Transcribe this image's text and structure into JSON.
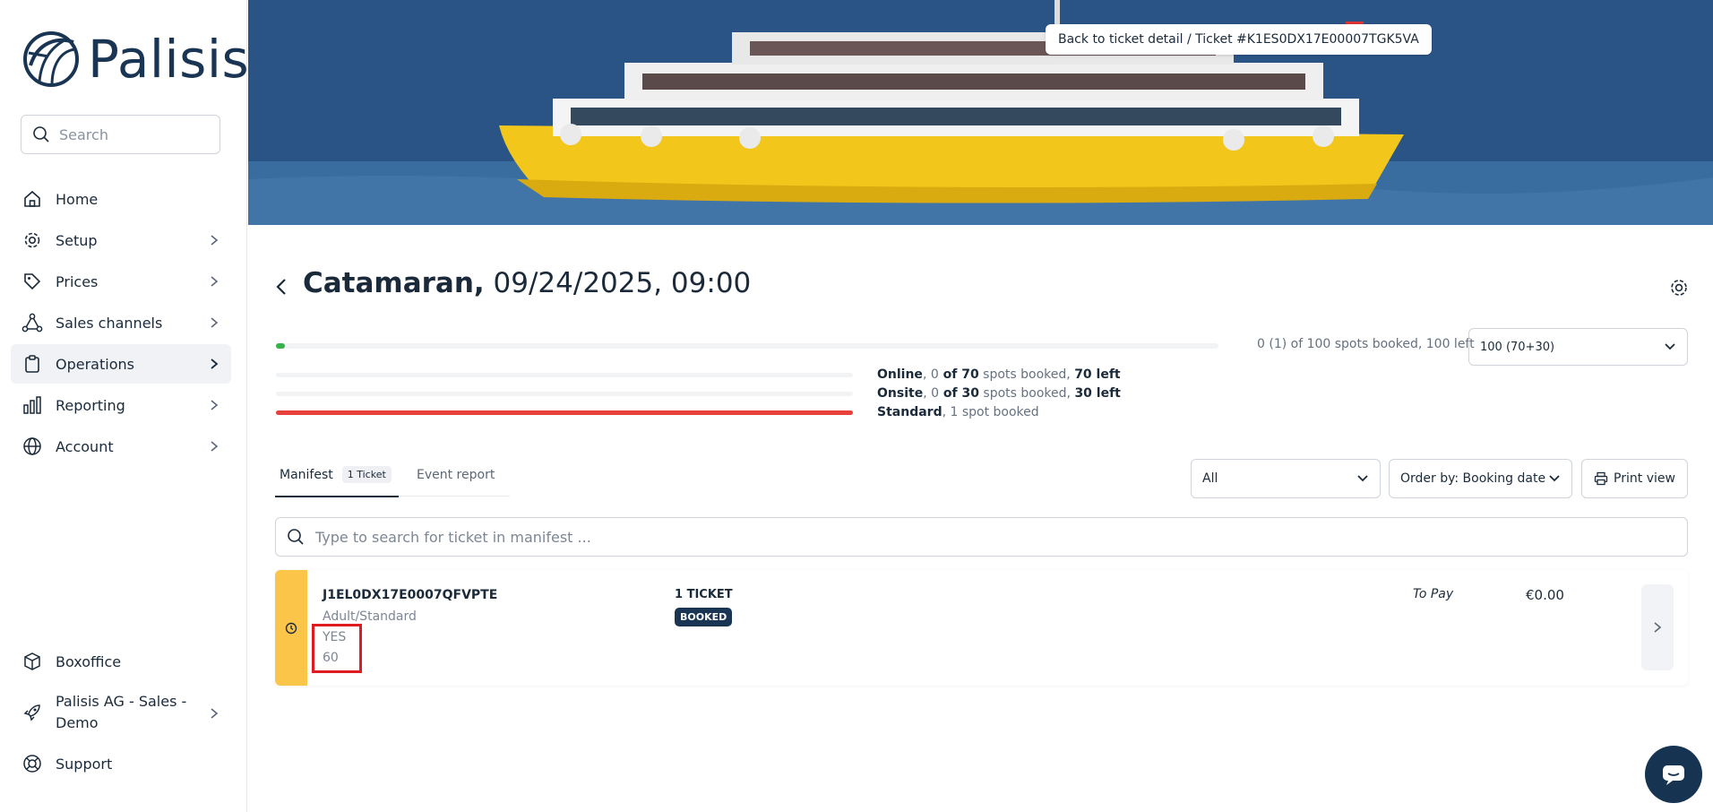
{
  "brand": {
    "name": "Palisis"
  },
  "sidebar": {
    "search_placeholder": "Search",
    "items": [
      {
        "label": "Home",
        "icon": "home-icon"
      },
      {
        "label": "Setup",
        "icon": "gear-icon"
      },
      {
        "label": "Prices",
        "icon": "tag-icon"
      },
      {
        "label": "Sales channels",
        "icon": "network-icon"
      },
      {
        "label": "Operations",
        "icon": "clipboard-icon"
      },
      {
        "label": "Reporting",
        "icon": "bar-chart-icon"
      },
      {
        "label": "Account",
        "icon": "globe-icon"
      }
    ],
    "bottom_items": [
      {
        "label": "Boxoffice",
        "icon": "box-icon"
      },
      {
        "label": "Palisis AG - Sales - Demo",
        "icon": "rocket-icon"
      },
      {
        "label": "Support",
        "icon": "lifebuoy-icon"
      }
    ]
  },
  "hero": {
    "breadcrumb": "Back to ticket detail / Ticket #K1ES0DX17E00007TGK5VA"
  },
  "event": {
    "title_bold": "Catamaran,",
    "title_rest": " 09/24/2025, 09:00"
  },
  "capacity": {
    "summary": "0 (1) of 100 spots booked, 100 left",
    "select_value": "100 (70+30)",
    "main_progress": 0.01,
    "rows": [
      {
        "name": "Online",
        "of_text": "0",
        "of_label": " of 70",
        "mid": " spots booked, ",
        "left": "70 left"
      },
      {
        "name": "Onsite",
        "of_text": "0",
        "of_label": " of 30",
        "mid": " spots booked, ",
        "left": "30 left"
      },
      {
        "name": "Standard",
        "tail": ", 1 spot booked"
      }
    ]
  },
  "tabs": {
    "manifest": "Manifest",
    "manifest_count": "1 Ticket",
    "event_report": "Event report"
  },
  "filters": {
    "status": "All",
    "order": "Order by: Booking date",
    "print": "Print view"
  },
  "manifest_search": {
    "placeholder": "Type to search for ticket in manifest ..."
  },
  "ticket": {
    "id": "J1EL0DX17E0007QFVPTE",
    "type": "Adult/Standard",
    "field1": "YES",
    "field2": "60",
    "count": "1 TICKET",
    "status": "BOOKED",
    "to_pay": "To Pay",
    "amount": "€0.00"
  },
  "colors": {
    "accent": "#1a3553",
    "ticket_strip": "#fbc54a",
    "progress_green": "#34b34a",
    "progress_red": "#e8403a",
    "highlight": "#e11b22"
  }
}
